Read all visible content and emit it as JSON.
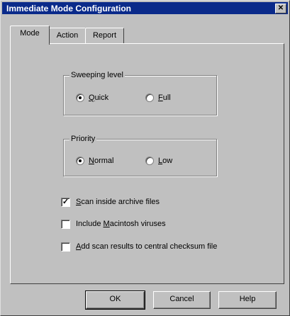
{
  "window": {
    "title": "Immediate Mode Configuration",
    "close_glyph": "✕"
  },
  "tabs": [
    {
      "label": "Mode",
      "active": true
    },
    {
      "label": "Action",
      "active": false
    },
    {
      "label": "Report",
      "active": false
    }
  ],
  "sweeping": {
    "legend": "Sweeping level",
    "options": [
      {
        "accel": "Q",
        "rest": "uick",
        "selected": true
      },
      {
        "accel": "F",
        "rest": "ull",
        "selected": false
      }
    ]
  },
  "priority": {
    "legend": "Priority",
    "options": [
      {
        "accel": "N",
        "rest": "ormal",
        "selected": true
      },
      {
        "accel": "L",
        "rest": "ow",
        "selected": false
      }
    ]
  },
  "options": [
    {
      "pre": "",
      "accel": "S",
      "rest": "can inside archive files",
      "checked": true
    },
    {
      "pre": "Include ",
      "accel": "M",
      "rest": "acintosh viruses",
      "checked": false
    },
    {
      "pre": "",
      "accel": "A",
      "rest": "dd scan results to central checksum file",
      "checked": false
    }
  ],
  "buttons": {
    "ok": "OK",
    "cancel": "Cancel",
    "help": "Help"
  },
  "marks": {
    "check": "✓"
  }
}
